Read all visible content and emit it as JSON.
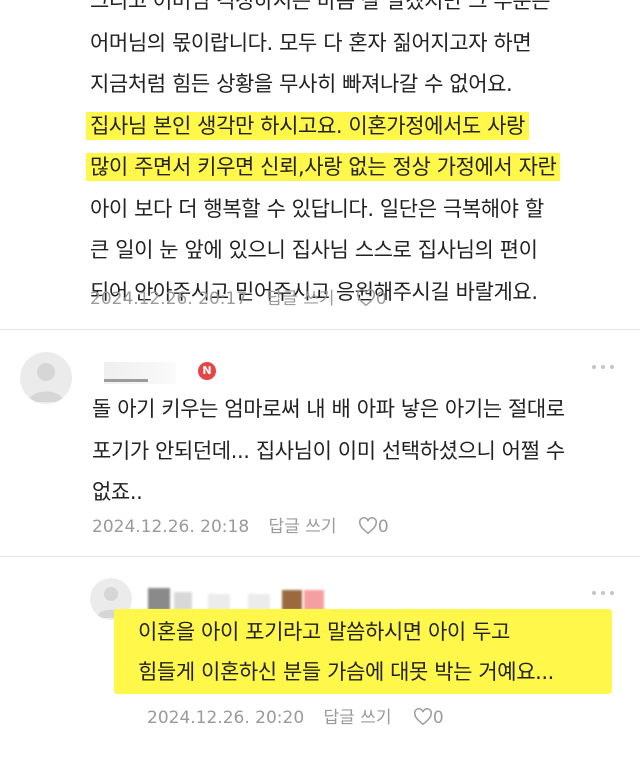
{
  "comments": [
    {
      "lines": [
        "그리고 어머님 걱정하시는 마음 잘 알겠지만 그 부분은",
        "어머님의 몫이랍니다. 모두 다 혼자 짊어지고자 하면",
        "지금처럼 힘든 상황을 무사히 빠져나갈 수 없어요.",
        "집사님 본인 생각만 하시고요. 이혼가정에서도 사랑",
        "많이 주면서 키우면 신뢰,사랑 없는 정상 가정에서 자란",
        "아이 보다 더 행복할 수 있답니다. 일단은 극복해야 할",
        "큰 일이 눈 앞에 있으니 집사님 스스로 집사님의 편이",
        "되어 안아주시고 믿어주시고 응원해주시길 바랄게요."
      ],
      "timestamp": "2024.12.26. 20:17",
      "reply_label": "답글 쓰기",
      "like_count": "0"
    },
    {
      "badge": "N",
      "lines": [
        "돌 아기 키우는 엄마로써 내 배 아파 낳은 아기는 절대로",
        "포기가 안되던데... 집사님이 이미 선택하셨으니 어쩔 수",
        "없죠.."
      ],
      "timestamp": "2024.12.26. 20:18",
      "reply_label": "답글 쓰기",
      "like_count": "0"
    },
    {
      "lines": [
        "이혼을 아이 포기라고 말씀하시면 아이 두고",
        "힘들게 이혼하신 분들 가슴에 대못 박는 거예요..."
      ],
      "timestamp": "2024.12.26. 20:20",
      "reply_label": "답글 쓰기",
      "like_count": "0"
    }
  ],
  "colors": {
    "highlight": "#fff74a",
    "badge": "#e64545",
    "meta_text": "#9a9a9a",
    "body_text": "#222222"
  },
  "icons": {
    "like": "heart-outline-icon",
    "more": "more-dots-icon",
    "avatar": "default-avatar-icon",
    "new_badge": "new-badge-icon"
  }
}
